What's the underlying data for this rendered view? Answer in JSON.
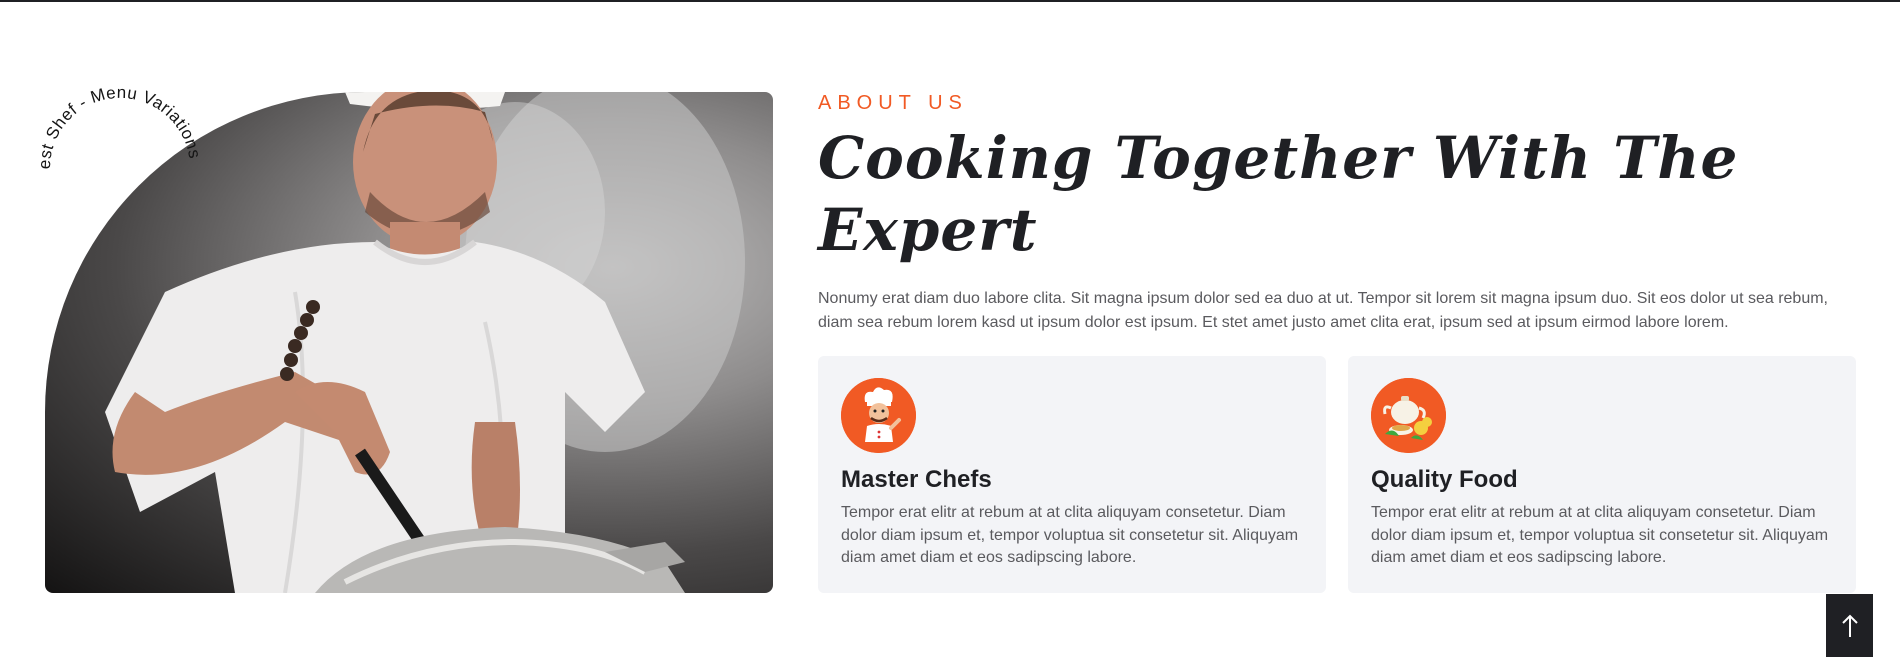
{
  "about": {
    "label": "ABOUT US",
    "heading": "Cooking Together With The Expert",
    "intro": "Nonumy erat diam duo labore clita. Sit magna ipsum dolor sed ea duo at ut. Tempor sit lorem sit magna ipsum duo. Sit eos dolor ut sea rebum, diam sea rebum lorem kasd ut ipsum dolor est ipsum. Et stet amet justo amet clita erat, ipsum sed at ipsum eirmod labore lorem."
  },
  "image": {
    "circle_text": "Best Shef - Menu Variations",
    "icon": "chef-photo"
  },
  "features": [
    {
      "icon": "chef-icon",
      "title": "Master Chefs",
      "text": "Tempor erat elitr at rebum at at clita aliquyam consetetur. Diam dolor diam ipsum et, tempor voluptua sit consetetur sit. Aliquyam diam amet diam et eos sadipscing labore."
    },
    {
      "icon": "teapot-icon",
      "title": "Quality Food",
      "text": "Tempor erat elitr at rebum at at clita aliquyam consetetur. Diam dolor diam ipsum et, tempor voluptua sit consetetur sit. Aliquyam diam amet diam et eos sadipscing labore."
    }
  ],
  "back_to_top": {
    "icon": "arrow-up-icon"
  },
  "colors": {
    "accent": "#f15a24",
    "dark": "#1f2024",
    "card_bg": "#f3f4f7",
    "body_text": "#5a5a5e"
  }
}
